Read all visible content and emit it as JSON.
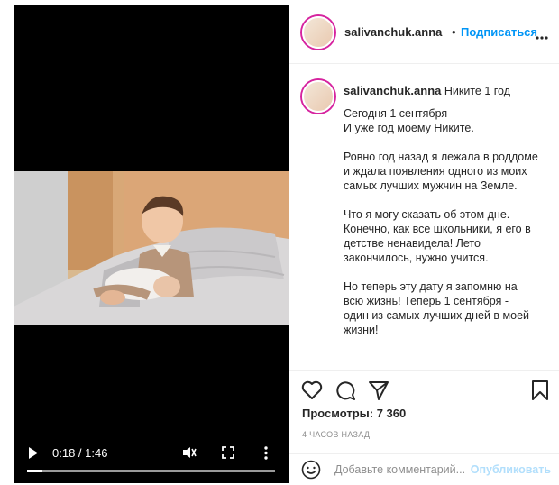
{
  "post": {
    "username": "salivanchuk.anna",
    "follow_separator": "•",
    "follow_label": "Подписаться",
    "more_icon_label": "•••"
  },
  "video": {
    "time_display": "0:18 / 1:46",
    "progress_fraction": 0.06
  },
  "caption": {
    "username": "salivanchuk.anna",
    "title": "Никите 1 год",
    "paragraphs": [
      "Сегодня 1 сентября\nИ уже год моему Никите.",
      "Ровно год назад я лежала в роддоме\nи ждала появления одного из моих\nсамых лучших мужчин на Земле.",
      "Что я могу сказать об этом дне.\nКонечно, как все школьники, я его в\nдетстве ненавидела! Лето\nзакончилось, нужно учится.",
      "Но теперь эту дату я запомню на\nвсю жизнь! Теперь 1 сентября -\nодин из самых лучших дней в моей\nжизни!"
    ]
  },
  "stats": {
    "views": "Просмотры: 7 360",
    "time_ago": "4 ЧАСОВ НАЗАД"
  },
  "comment": {
    "placeholder": "Добавьте комментарий...",
    "publish_label": "Опубликовать"
  },
  "colors": {
    "link_blue": "#0095f6",
    "publish_disabled": "#b2dffc",
    "muted_text": "#8e8e8e"
  }
}
